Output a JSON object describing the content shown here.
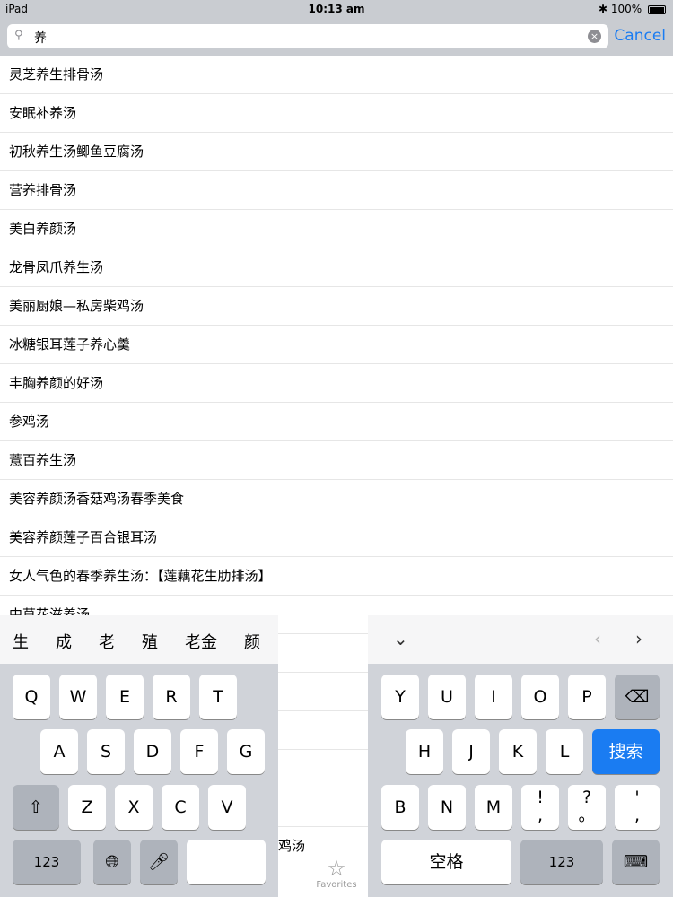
{
  "status": {
    "device": "iPad",
    "time": "10:13 am",
    "battery": "100%"
  },
  "search": {
    "query": "养",
    "cancel": "Cancel"
  },
  "results": [
    "灵芝养生排骨汤",
    "安眠补养汤",
    "初秋养生汤鲫鱼豆腐汤",
    "营养排骨汤",
    "美白养颜汤",
    "龙骨凤爪养生汤",
    "美丽厨娘—私房柴鸡汤",
    "冰糖银耳莲子养心羹",
    "丰胸养颜的好汤",
    "参鸡汤",
    "薏百养生汤",
    "美容养颜汤香菇鸡汤春季美食",
    "美容养颜莲子百合银耳汤",
    "女人气色的春季养生汤：【莲藕花生肋排汤】",
    "中草花滋养汤"
  ],
  "peek_text": "鸡汤",
  "candidates": [
    "生",
    "成",
    "老",
    "殖",
    "老金",
    "颜"
  ],
  "keyboard": {
    "left_row1": [
      "Q",
      "W",
      "E",
      "R",
      "T"
    ],
    "left_row2": [
      "A",
      "S",
      "D",
      "F",
      "G"
    ],
    "left_row3": [
      "Z",
      "X",
      "C",
      "V"
    ],
    "left_num": "123",
    "right_row1": [
      "Y",
      "U",
      "I",
      "O",
      "P"
    ],
    "right_row2": [
      "H",
      "J",
      "K",
      "L"
    ],
    "search_key": "搜索",
    "right_row3": [
      "B",
      "N",
      "M",
      "!\n,",
      "?\n。",
      "'\n,"
    ],
    "space": "空格",
    "right_num": "123"
  },
  "tabbar": {
    "favorites": "Favorites"
  }
}
